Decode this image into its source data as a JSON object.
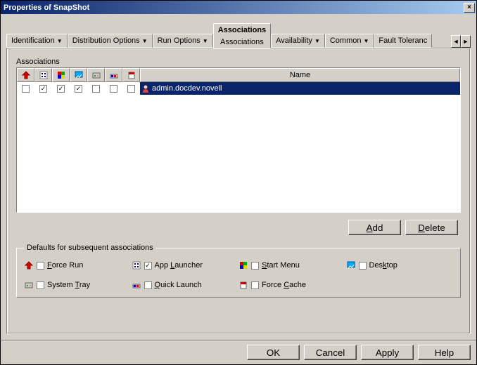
{
  "window": {
    "title": "Properties of SnapShot",
    "close": "×"
  },
  "tabs": {
    "identification": "Identification",
    "distribution": "Distribution Options",
    "run": "Run Options",
    "associations": "Associations",
    "associations_sub": "Associations",
    "availability": "Availability",
    "common": "Common",
    "fault": "Fault Toleranc"
  },
  "scroll": {
    "left": "◄",
    "right": "►"
  },
  "assoc": {
    "label": "Associations",
    "name_col": "Name",
    "row_name": "admin.docdev.novell",
    "checks": [
      false,
      true,
      true,
      true,
      false,
      false,
      false
    ]
  },
  "buttons": {
    "add": "Add",
    "delete": "Delete"
  },
  "defaults": {
    "legend": "Defaults for subsequent associations",
    "force_run": "Force Run",
    "app_launcher": "App Launcher",
    "start_menu": "Start Menu",
    "desktop": "Desktop",
    "system_tray": "System Tray",
    "quick_launch": "Quick Launch",
    "force_cache": "Force Cache",
    "app_launcher_checked": true
  },
  "footer": {
    "ok": "OK",
    "cancel": "Cancel",
    "apply": "Apply",
    "help": "Help"
  }
}
